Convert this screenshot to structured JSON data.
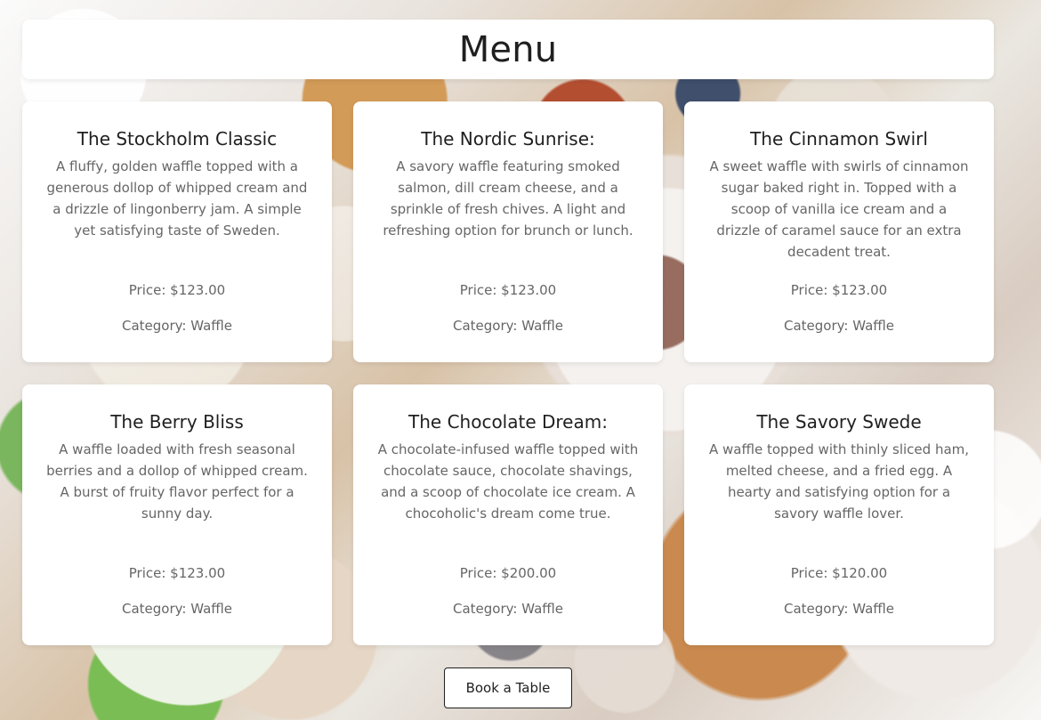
{
  "page": {
    "title": "Menu"
  },
  "menu": {
    "items": [
      {
        "name": "The Stockholm Classic",
        "description": "A fluffy, golden waffle topped with a generous dollop of whipped cream and a drizzle of lingonberry jam. A simple yet satisfying taste of Sweden.",
        "price": "Price: $123.00",
        "category": "Category: Waffle"
      },
      {
        "name": "The Nordic Sunrise:",
        "description": "A savory waffle featuring smoked salmon, dill cream cheese, and a sprinkle of fresh chives. A light and refreshing option for brunch or lunch.",
        "price": "Price: $123.00",
        "category": "Category: Waffle"
      },
      {
        "name": "The Cinnamon Swirl",
        "description": "A sweet waffle with swirls of cinnamon sugar baked right in. Topped with a scoop of vanilla ice cream and a drizzle of caramel sauce for an extra decadent treat.",
        "price": "Price: $123.00",
        "category": "Category: Waffle"
      },
      {
        "name": "The Berry Bliss",
        "description": "A waffle loaded with fresh seasonal berries and a dollop of whipped cream. A burst of fruity flavor perfect for a sunny day.",
        "price": "Price: $123.00",
        "category": "Category: Waffle"
      },
      {
        "name": "The Chocolate Dream:",
        "description": "A chocolate-infused waffle topped with chocolate sauce, chocolate shavings, and a scoop of chocolate ice cream. A chocoholic's dream come true.",
        "price": "Price: $200.00",
        "category": "Category: Waffle"
      },
      {
        "name": "The Savory Swede",
        "description": "A waffle topped with thinly sliced ham, melted cheese, and a fried egg. A hearty and satisfying option for a savory waffle lover.",
        "price": "Price: $120.00",
        "category": "Category: Waffle"
      }
    ]
  },
  "actions": {
    "book_label": "Book a Table"
  }
}
